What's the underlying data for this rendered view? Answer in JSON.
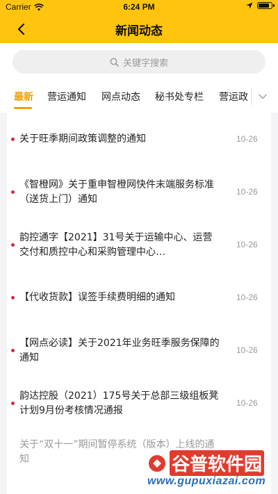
{
  "status_bar": {
    "carrier": "Carrier",
    "time": "6:24 PM",
    "battery_level": 0.95
  },
  "header": {
    "title": "新闻动态",
    "back_icon": "chevron-left-icon"
  },
  "search": {
    "placeholder": "关键字搜索"
  },
  "tabs": [
    {
      "label": "最新",
      "active": true
    },
    {
      "label": "营运通知",
      "active": false
    },
    {
      "label": "网点动态",
      "active": false
    },
    {
      "label": "秘书处专栏",
      "active": false
    },
    {
      "label": "营运政",
      "active": false
    }
  ],
  "news": [
    {
      "title": "关于旺季期间政策调整的通知",
      "date": "10-26"
    },
    {
      "title": "《智橙网》关于重申智橙网快件末端服务标准（送货上门）通知",
      "date": "10-26"
    },
    {
      "title": "韵控通字【2021】31号关于运输中心、运营交付和质控中心和采购管理中心…",
      "date": "10-26"
    },
    {
      "title": "【代收货款】误签手续费明细的通知",
      "date": "10-26"
    },
    {
      "title": "【网点必读】关于2021年业务旺季服务保障的通知",
      "date": "10-26"
    },
    {
      "title": "韵达控股（2021）175号关于总部三级组板凳计划9月份考核情况通报",
      "date": "10-26"
    },
    {
      "title": "关于“双十一”期间暂停系统（版本）上线的通知",
      "date": ""
    }
  ],
  "watermark": {
    "brand": "谷普软件园",
    "url": "www.gupuxiazai.com"
  },
  "colors": {
    "header": "#FFC40D",
    "accent": "#F2A000",
    "dot": "#D7264A"
  }
}
